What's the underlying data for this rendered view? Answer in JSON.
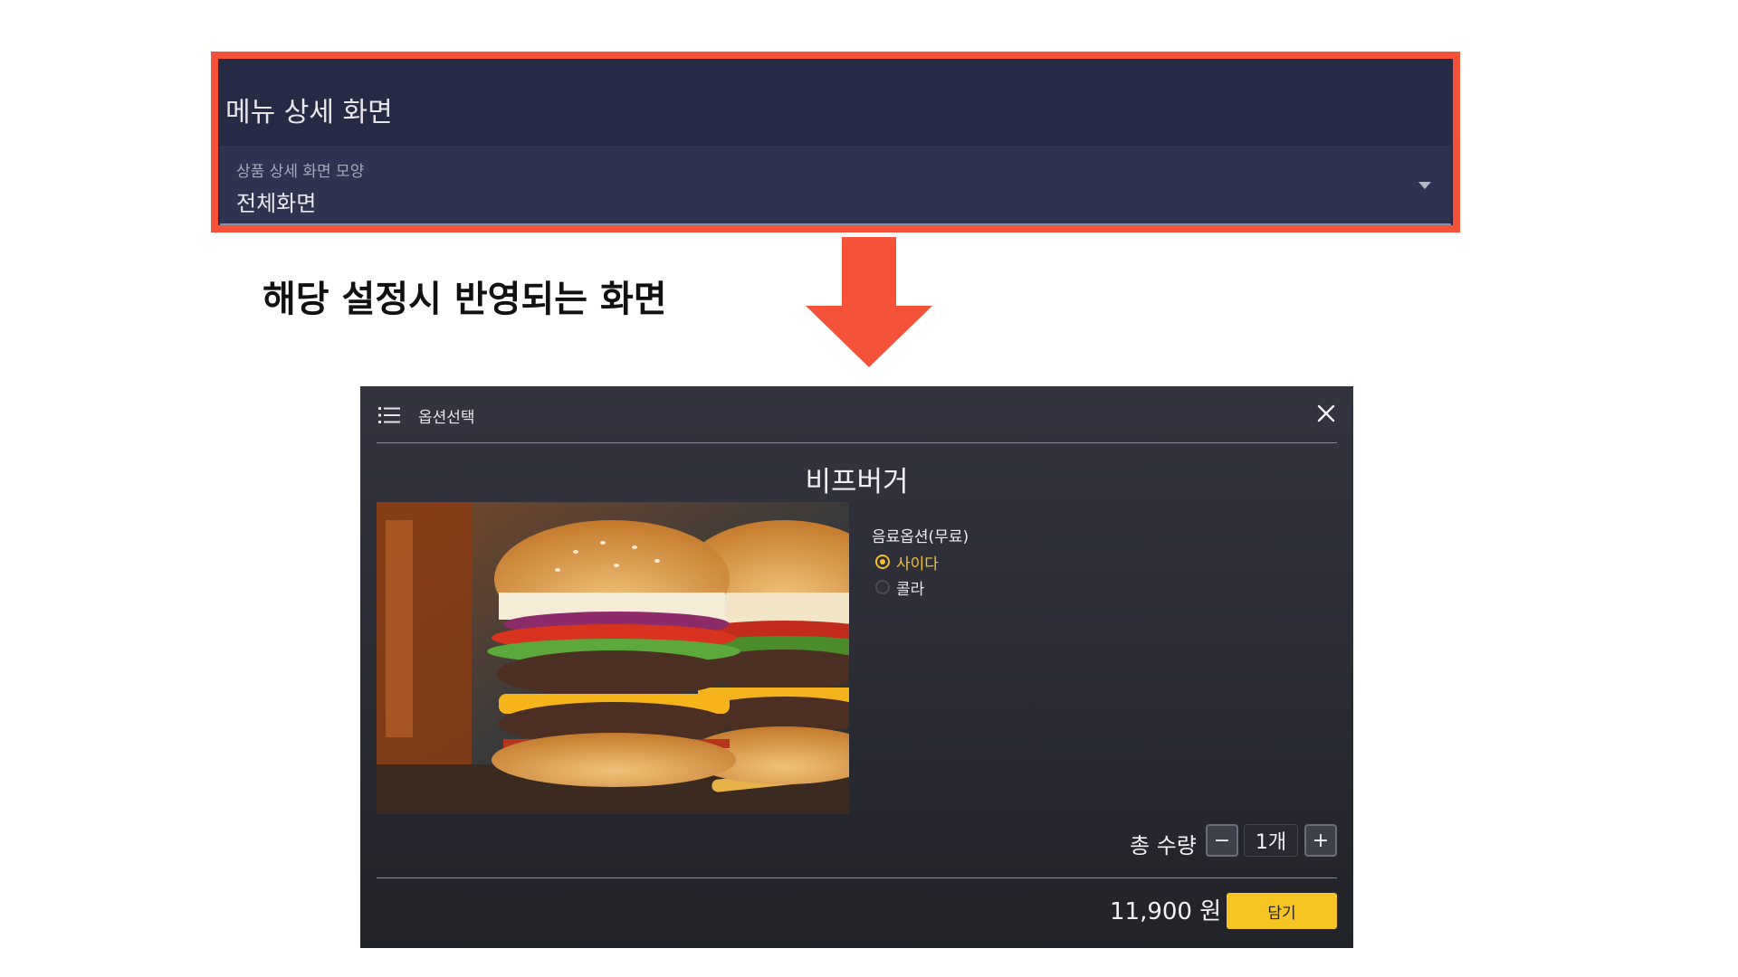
{
  "settings": {
    "section_title": "메뉴 상세 화면",
    "field_label": "상품 상세 화면 모양",
    "field_value": "전체화면",
    "highlight_color": "#f4533a"
  },
  "caption": "해당 설정시 반영되는 화면",
  "modal": {
    "title": "옵션선택",
    "product_name": "비프버거",
    "option_group_title": "음료옵션(무료)",
    "options": [
      {
        "label": "사이다",
        "selected": true
      },
      {
        "label": "콜라",
        "selected": false
      }
    ],
    "quantity_label": "총 수량",
    "quantity_value": "1개",
    "minus_label": "−",
    "plus_label": "+",
    "price": "11,900 원",
    "add_button_label": "담기",
    "accent_color": "#f7c523"
  },
  "icons": [
    "list-icon",
    "close-icon",
    "chevron-down-icon",
    "arrow-down-icon"
  ]
}
